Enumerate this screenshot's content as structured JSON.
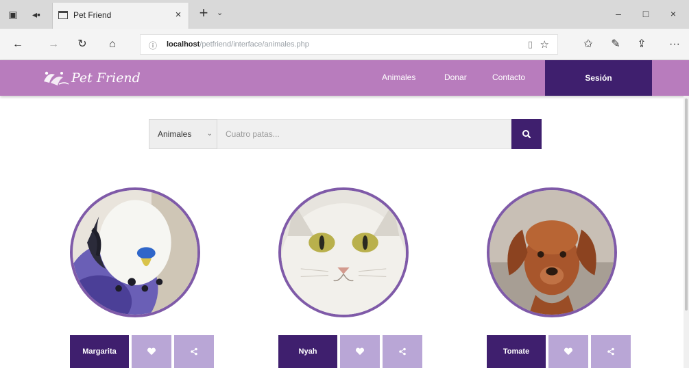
{
  "browser": {
    "tab_title": "Pet Friend",
    "tab_close": "×",
    "new_tab": "+",
    "tab_menu": "⌄",
    "address_host": "localhost",
    "address_path": "/petfriend/interface/animales.php",
    "win_minimize": "–",
    "win_maximize": "□",
    "win_close": "×",
    "more": "···"
  },
  "site": {
    "logo_text": "Pet Friend",
    "menu": [
      "Animales",
      "Donar",
      "Contacto"
    ],
    "session_label": "Sesión",
    "header_color": "#b87cbd",
    "accent_color": "#3f1f6e",
    "action_color": "#b9a6d6"
  },
  "search": {
    "category": "Animales",
    "placeholder": "Cuatro patas..."
  },
  "pets": [
    {
      "name": "Margarita",
      "photo": "parakeet"
    },
    {
      "name": "Nyah",
      "photo": "cat"
    },
    {
      "name": "Tomate",
      "photo": "puppy"
    }
  ]
}
